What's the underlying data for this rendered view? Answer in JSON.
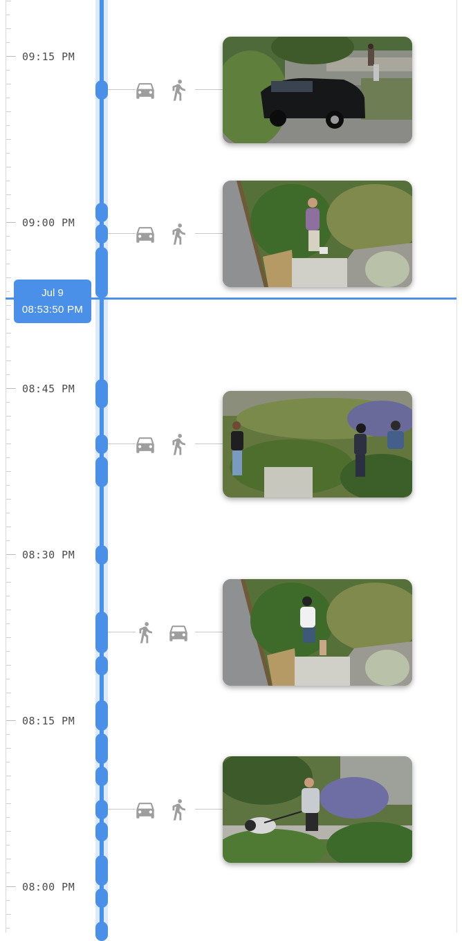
{
  "timeline": {
    "time_labels": [
      "09:15 PM",
      "09:00 PM",
      "08:45 PM",
      "08:30 PM",
      "08:15 PM",
      "08:00 PM"
    ],
    "accent_color": "#4a90e8"
  },
  "current_marker": {
    "date": "Jul 9",
    "time": "08:53:50 PM"
  },
  "events": [
    {
      "icons": [
        "car-icon",
        "pedestrian-icon"
      ],
      "snapshot": "black SUV parked on street with people walking behind"
    },
    {
      "icons": [
        "car-icon",
        "pedestrian-icon"
      ],
      "snapshot": "man in purple shirt walking past garden"
    },
    {
      "icons": [
        "car-icon",
        "pedestrian-icon"
      ],
      "snapshot": "three people walking past garden"
    },
    {
      "icons": [
        "pedestrian-icon",
        "car-icon"
      ],
      "snapshot": "man in white shirt walking past garden"
    },
    {
      "icons": [
        "car-icon",
        "pedestrian-icon"
      ],
      "snapshot": "man walking a dog past garden"
    }
  ]
}
